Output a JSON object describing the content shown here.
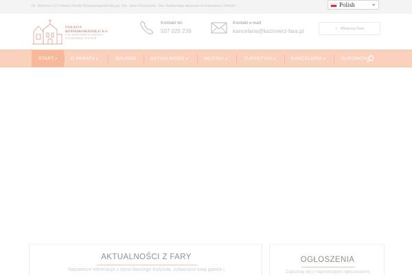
{
  "topbar": {
    "text": "Ul. Wolności 12 Galeria Parafii Rzymskokatolickiej pw. Św. Jana Chrzciciela i Św. Bartłomieja Apostoła w Kazimierzu Dolnym",
    "language": {
      "selected": "Polish",
      "icon": "poland-flag-icon"
    }
  },
  "logo": {
    "title": "PARAFIA RZYMSKOKATOLICKA",
    "lines": [
      "PW. ŚW. JANA CHRZCICIELA",
      "I ŚW. BARTŁOMIEJA APOSTOŁA",
      "W KAZIMIERZU DOLNYM"
    ]
  },
  "contacts": [
    {
      "label": "Kontakt tel.",
      "value": "507 025 239",
      "icon": "phone-icon"
    },
    {
      "label": "Kontakt e-mail",
      "value": "kancelaria@kazimierz-fara.pl",
      "icon": "envelope-icon"
    }
  ],
  "donate_button": {
    "label": "Wesprzyj Farę"
  },
  "nav": {
    "items": [
      {
        "label": "START",
        "caret": "▾",
        "active": true
      },
      {
        "label": "O PARAFII",
        "caret": "▾"
      },
      {
        "label": "GALERIE",
        "caret": ""
      },
      {
        "label": "AKTUALNOŚCI",
        "caret": "▾"
      },
      {
        "label": "MUZYKA",
        "caret": "▾"
      },
      {
        "label": "TURYSTYKA",
        "caret": "▾"
      },
      {
        "label": "KANCELARIA",
        "caret": "▾"
      },
      {
        "label": "DAROWIZNY",
        "caret": ""
      }
    ]
  },
  "news": {
    "title": "AKTUALNOŚCI Z FARY",
    "description": "Najnowsze informacje z życia Naszego Kościoła, zobaczysz tutaj galerie i"
  },
  "announcements": {
    "title": "OGŁOSZENIA",
    "description": "Zapoznaj się z najnowszymi ogłoszeniami"
  },
  "colors": {
    "nav_background": "#fad1bd",
    "nav_active": "#f8b99a",
    "accent": "#f0c6b4"
  }
}
